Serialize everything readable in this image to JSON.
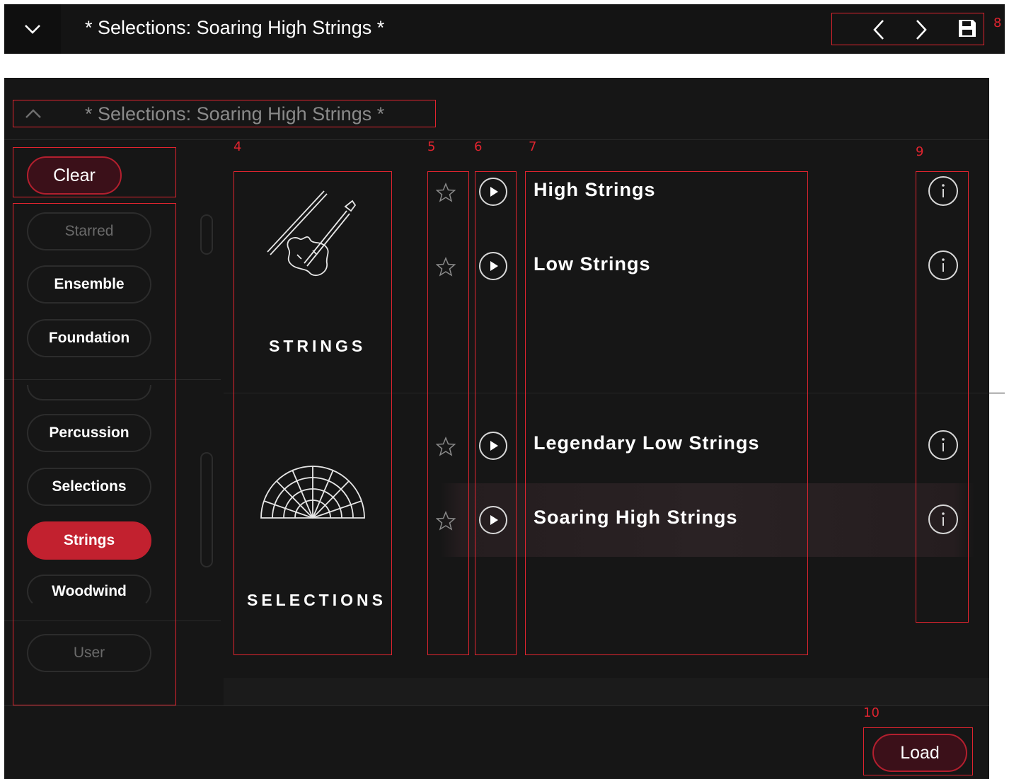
{
  "header": {
    "title": "* Selections: Soaring High Strings *"
  },
  "browser": {
    "title": "* Selections: Soaring High Strings *",
    "clear_label": "Clear",
    "load_label": "Load",
    "categories": [
      "Starred",
      "Ensemble",
      "Foundation",
      "Percussion",
      "Selections",
      "Strings",
      "Woodwind",
      "User"
    ],
    "active_category": "Strings",
    "groups": [
      {
        "label": "STRINGS",
        "icon": "violin-icon"
      },
      {
        "label": "SELECTIONS",
        "icon": "orchestra-seating-icon"
      }
    ],
    "presets": [
      {
        "name": "High Strings"
      },
      {
        "name": "Low Strings"
      },
      {
        "name": "Legendary Low Strings"
      },
      {
        "name": "Soaring High Strings",
        "selected": true
      }
    ]
  },
  "annotations": [
    "4",
    "5",
    "6",
    "7",
    "8",
    "9",
    "10"
  ],
  "colors": {
    "accent": "#c2212f",
    "annotation": "#e0242f",
    "background": "#161616"
  }
}
